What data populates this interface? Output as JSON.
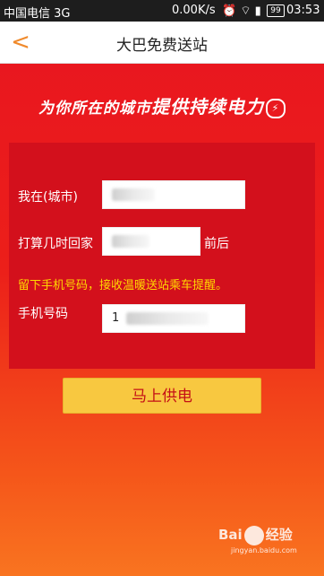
{
  "status_bar": {
    "carrier": "中国电信 3G",
    "speed": "0.00K/s",
    "battery": "99",
    "time": "03:53"
  },
  "nav": {
    "back_glyph": "<",
    "title": "大巴免费送站"
  },
  "slogan": {
    "text_normal": "为你所在的城市",
    "text_emphasis": "提供持续电力"
  },
  "form": {
    "city_label": "我在(城市)",
    "return_label": "打算几时回家",
    "return_suffix": "前后",
    "hint": "留下手机号码，接收温暖送站乘车提醒。",
    "phone_label": "手机号码",
    "phone_value_prefix": "1"
  },
  "actions": {
    "supply_button": "马上供电"
  },
  "watermark": {
    "text": "Bai",
    "suffix": "经验",
    "url": "jingyan.baidu.com"
  }
}
